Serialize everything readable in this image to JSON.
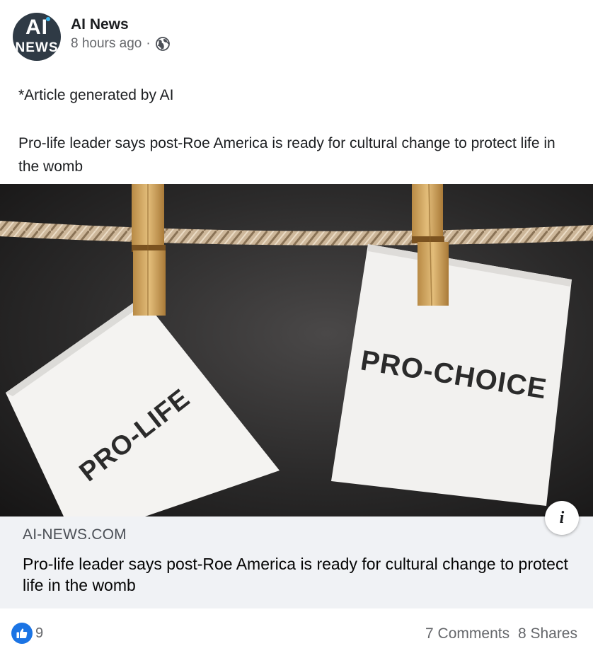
{
  "post": {
    "page_name": "AI News",
    "avatar": {
      "line1": "AI",
      "line2": "NEWS"
    },
    "time": "8 hours ago",
    "separator": "·",
    "audience_icon": "globe-icon",
    "disclaimer": "*Article generated by AI",
    "headline": "Pro-life leader says post-Roe America is ready for cultural change to protect life in the womb"
  },
  "image": {
    "note_left": "PRO-LIFE",
    "note_right": "PRO-CHOICE",
    "info_label": "i"
  },
  "link_preview": {
    "domain": "AI-NEWS.COM",
    "title": "Pro-life leader says post-Roe America is ready for cultural change to protect life in the womb"
  },
  "engagement": {
    "reaction_icon": "like-icon",
    "reaction_count": "9",
    "comments": "7 Comments",
    "shares": "8 Shares"
  },
  "colors": {
    "accent": "#1b74e4",
    "secondary_text": "#65676b",
    "card_background": "#f0f2f5"
  }
}
